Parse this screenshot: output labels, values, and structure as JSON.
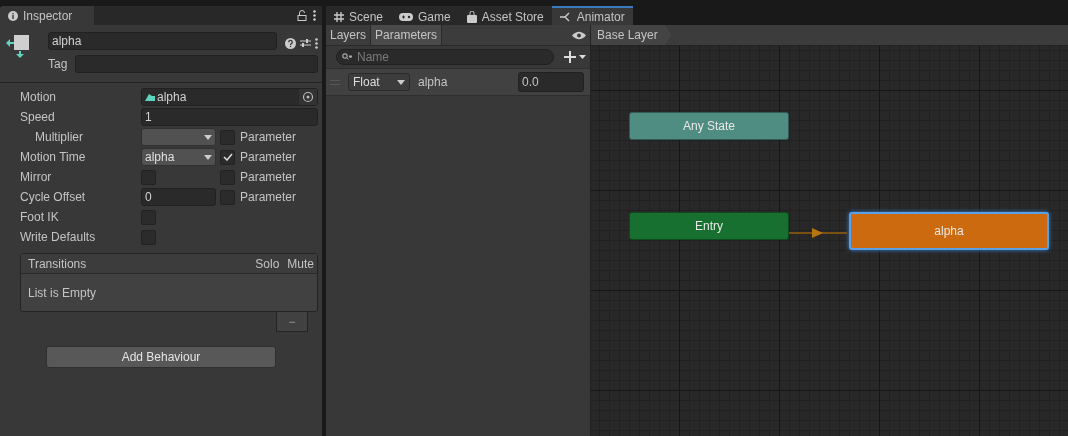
{
  "inspector": {
    "tab": "Inspector",
    "name": "alpha",
    "tag_label": "Tag",
    "properties": [
      {
        "kind": "object",
        "label": "Motion",
        "value": "alpha"
      },
      {
        "kind": "text",
        "label": "Speed",
        "value": "1",
        "children": [
          {
            "kind": "dropdown",
            "label": "Multiplier",
            "param_checked": false,
            "param_label": "Parameter"
          }
        ]
      },
      {
        "kind": "dropdown",
        "label": "Motion Time",
        "value": "alpha",
        "param_checked": true,
        "param_label": "Parameter"
      },
      {
        "kind": "checkbox",
        "label": "Mirror",
        "checked": false,
        "param_checked": false,
        "param_label": "Parameter"
      },
      {
        "kind": "number",
        "label": "Cycle Offset",
        "value": "0",
        "param_checked": false,
        "param_label": "Parameter"
      },
      {
        "kind": "checkbox",
        "label": "Foot IK",
        "checked": false
      },
      {
        "kind": "checkbox",
        "label": "Write Defaults",
        "checked": false
      }
    ],
    "transitions": {
      "title": "Transitions",
      "columns": [
        "Solo",
        "Mute"
      ],
      "empty_text": "List is Empty",
      "remove_button": "−"
    },
    "add_button": "Add Behaviour"
  },
  "tabs": [
    {
      "label": "Scene",
      "kind": "scene",
      "selected": false
    },
    {
      "label": "Game",
      "kind": "game",
      "selected": false
    },
    {
      "label": "Asset Store",
      "kind": "store",
      "selected": false
    },
    {
      "label": "Animator",
      "kind": "animator",
      "selected": true
    }
  ],
  "animator": {
    "subtabs": [
      {
        "label": "Layers",
        "selected": false
      },
      {
        "label": "Parameters",
        "selected": true
      }
    ],
    "search": {
      "placeholder": "Name"
    },
    "parameters": [
      {
        "type": "Float",
        "name": "alpha",
        "value": "0.0"
      }
    ],
    "breadcrumb": "Base Layer",
    "nodes": [
      {
        "label": "Any State",
        "color": "#4f8c82",
        "selected": false
      },
      {
        "label": "Entry",
        "color": "#17702f",
        "selected": false
      },
      {
        "label": "alpha",
        "color": "#cc6a10",
        "selected": true
      }
    ]
  }
}
